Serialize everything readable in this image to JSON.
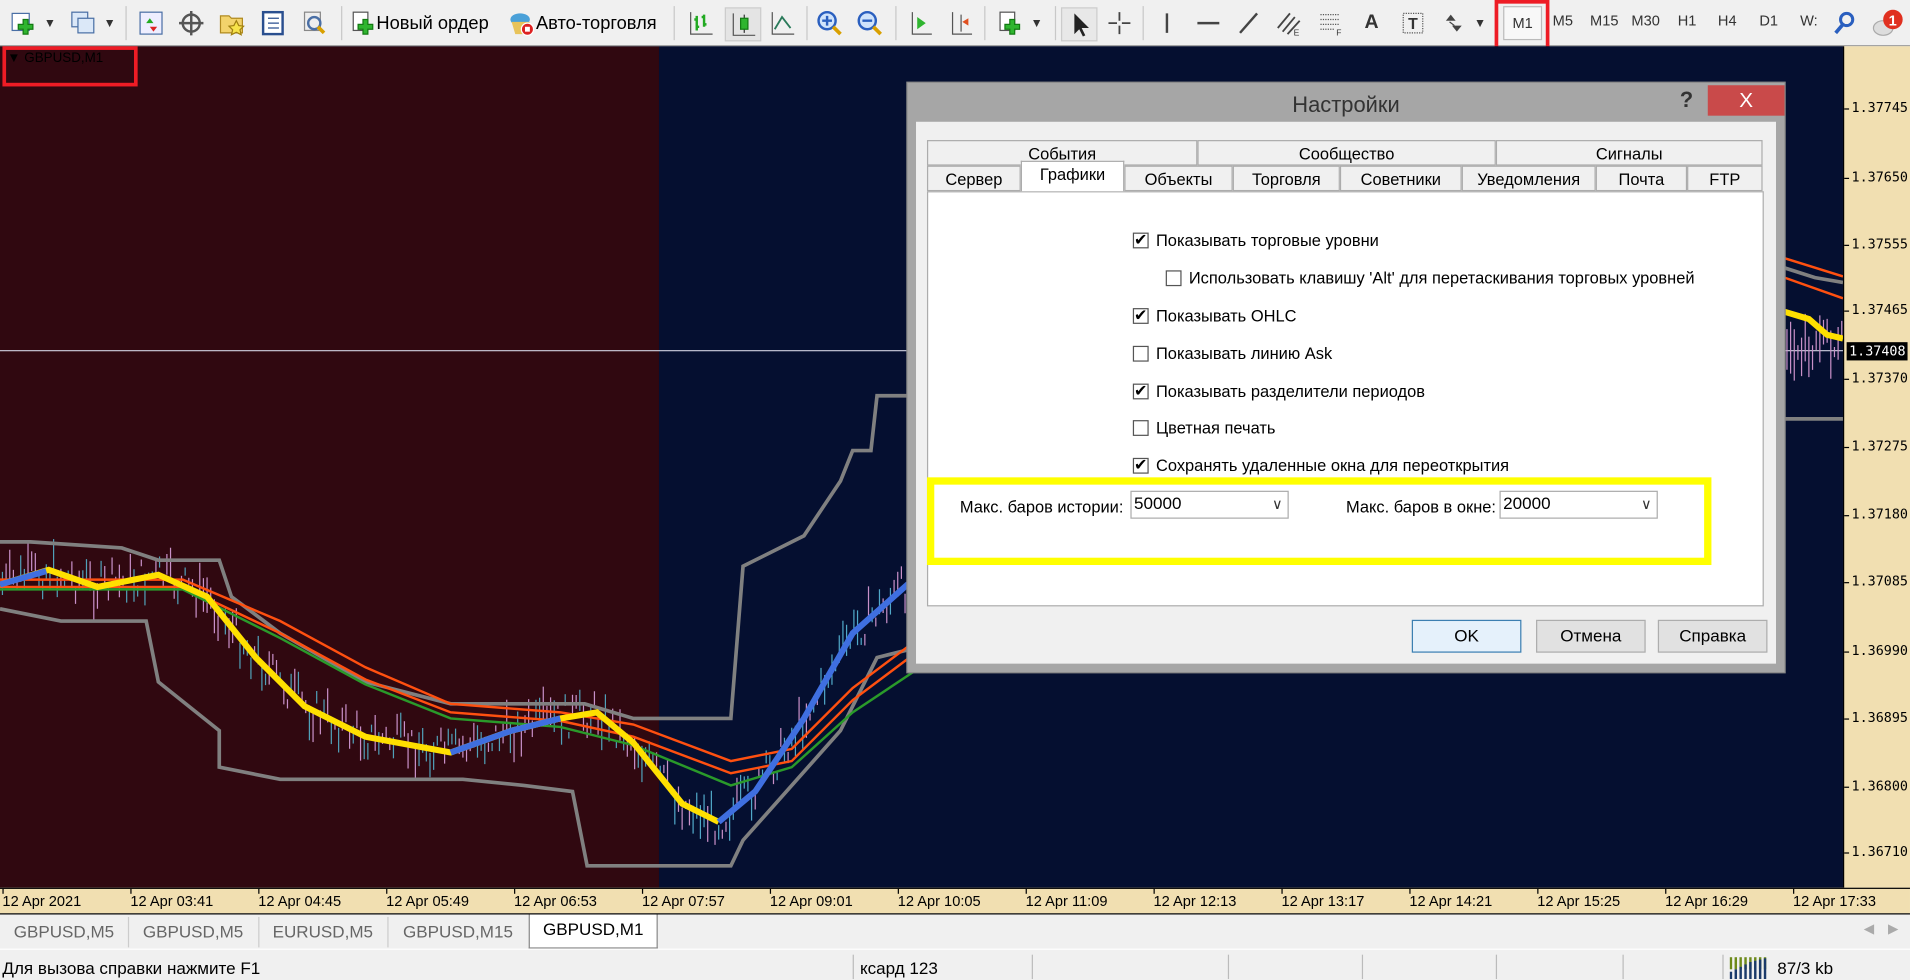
{
  "toolbar": {
    "new_order_label": "Новый ордер",
    "auto_trading_label": "Авто-торговля",
    "timeframes": [
      "M1",
      "M5",
      "M15",
      "M30",
      "H1",
      "H4",
      "D1",
      "W:"
    ],
    "active_timeframe": "M1",
    "notification_count": "1"
  },
  "chart": {
    "title": "GBPUSD,M1",
    "current_price": "1.37408",
    "price_ticks": [
      "1.37745",
      "1.37650",
      "1.37555",
      "1.37465",
      "1.37370",
      "1.37275",
      "1.37180",
      "1.37085",
      "1.36990",
      "1.36895",
      "1.36800",
      "1.36710"
    ],
    "time_ticks": [
      "12 Apr 2021",
      "12 Apr 03:41",
      "12 Apr 04:45",
      "12 Apr 05:49",
      "12 Apr 06:53",
      "12 Apr 07:57",
      "12 Apr 09:01",
      "12 Apr 10:05",
      "12 Apr 11:09",
      "12 Apr 12:13",
      "12 Apr 13:17",
      "12 Apr 14:21",
      "12 Apr 15:25",
      "12 Apr 16:29",
      "12 Apr 17:33"
    ],
    "colors": {
      "session_a_bg": "#300810",
      "session_b_bg": "#050f30",
      "ma_up": "#3f6fe0",
      "ma_down": "#ffe000",
      "channel": "#808080",
      "ema": "#ff5010",
      "green": "#2a9a2a"
    }
  },
  "chart_tabs": [
    {
      "label": "GBPUSD,M5"
    },
    {
      "label": "GBPUSD,M5"
    },
    {
      "label": "EURUSD,M5"
    },
    {
      "label": "GBPUSD,M15"
    },
    {
      "label": "GBPUSD,M1",
      "active": true
    }
  ],
  "status": {
    "help_text": "Для вызова справки нажмите F1",
    "profile": "ксард 123",
    "traffic": "87/3 kb"
  },
  "dialog": {
    "title": "Настройки",
    "help": "?",
    "close": "X",
    "tabs_row1": [
      "События",
      "Сообщество",
      "Сигналы"
    ],
    "tabs_row2": [
      "Сервер",
      "Графики",
      "Объекты",
      "Торговля",
      "Советники",
      "Уведомления",
      "Почта",
      "FTP"
    ],
    "active_tab": "Графики",
    "options": [
      {
        "label": "Показывать торговые уровни",
        "checked": true
      },
      {
        "label": "Использовать клавишу 'Alt' для перетаскивания торговых уровней",
        "checked": false
      },
      {
        "label": "Показывать OHLC",
        "checked": true
      },
      {
        "label": "Показывать линию Ask",
        "checked": false
      },
      {
        "label": "Показывать разделители периодов",
        "checked": true
      },
      {
        "label": "Цветная печать",
        "checked": false
      },
      {
        "label": "Сохранять удаленные окна для переоткрытия",
        "checked": true
      }
    ],
    "max_bars_history_label": "Макс. баров истории:",
    "max_bars_history_value": "50000",
    "max_bars_window_label": "Макс. баров в окне:",
    "max_bars_window_value": "20000",
    "ok": "OK",
    "cancel": "Отмена",
    "help_button": "Справка"
  }
}
